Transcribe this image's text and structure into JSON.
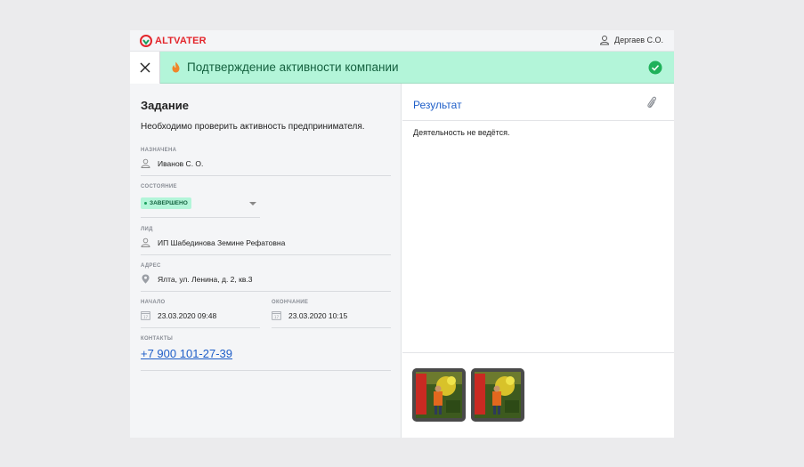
{
  "app": {
    "logo_text": "ALTVATER",
    "user_name": "Дергаев С.О.",
    "brand_color": "#e3262c"
  },
  "banner": {
    "title": "Подтверждение активности компании",
    "background": "#b3f5d9",
    "icons": [
      "close-icon",
      "flame-icon",
      "check-circle-icon"
    ]
  },
  "task": {
    "heading": "Задание",
    "description": "Необходимо проверить активность предпринимателя.",
    "assigned": {
      "label": "НАЗНАЧЕНА",
      "value": "Иванов С. О."
    },
    "status": {
      "label": "СОСТОЯНИЕ",
      "value": "ЗАВЕРШЕНО"
    },
    "lead": {
      "label": "ЛИД",
      "value": "ИП Шабединова Земине Рефатовна"
    },
    "address": {
      "label": "АДРЕС",
      "value": "Ялта, ул. Ленина, д. 2, кв.3"
    },
    "start": {
      "label": "НАЧАЛО",
      "value": "23.03.2020 09:48"
    },
    "end": {
      "label": "ОКОНЧАНИЕ",
      "value": "23.03.2020 10:15"
    },
    "contacts": {
      "label": "КОНТАКТЫ",
      "value": "+7 900 101-27-39"
    }
  },
  "result": {
    "heading": "Результат",
    "text": "Деятельность не ведётся.",
    "attachments": [
      "photo-1",
      "photo-2"
    ]
  }
}
